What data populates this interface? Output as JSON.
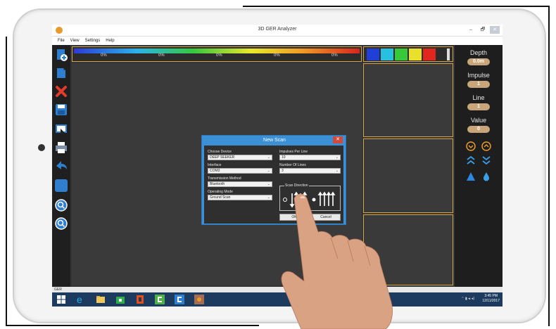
{
  "window": {
    "title": "3D GER Analyzer",
    "minimize": "–",
    "maximize": "🗗",
    "close": "✕"
  },
  "menu": [
    "File",
    "View",
    "Settings",
    "Help"
  ],
  "scale": {
    "percent_labels": [
      "0%",
      "0%",
      "0%",
      "0%",
      "0%"
    ]
  },
  "swatches": [
    "#1f3fd6",
    "#28c0e0",
    "#37c93c",
    "#e8e02a",
    "#e0261f"
  ],
  "sidebar": {
    "depth_label": "Depth",
    "depth_value": "0.0m",
    "impulse_label": "Impulse",
    "impulse_value": "1",
    "line_label": "Line",
    "line_value": "1",
    "value_label": "Value",
    "value_value": "0"
  },
  "dialog": {
    "title": "New Scan",
    "close": "✕",
    "choose_device_label": "Choose Device",
    "choose_device_value": "DEEP SEEKER",
    "interface_label": "Interface",
    "interface_value": "COM3",
    "transmission_label": "Transmission Method",
    "transmission_value": "Bluetooth",
    "operating_mode_label": "Operating Mode",
    "operating_mode_value": "Ground Scan",
    "impulses_label": "Impulses Per Line",
    "impulses_value": "10",
    "lines_label": "Number Of Lines",
    "lines_value": "3",
    "scan_direction_label": "Scan Direction",
    "ok_label": "OK",
    "cancel_label": "Cancel"
  },
  "status": {
    "text": "GER"
  },
  "taskbar": {
    "time": "3:45 PM",
    "date": "12/11/2017"
  },
  "colors": {
    "accent": "#d4a44a",
    "dialog_blue": "#3b90d6",
    "taskbar": "#1d3b5f"
  }
}
